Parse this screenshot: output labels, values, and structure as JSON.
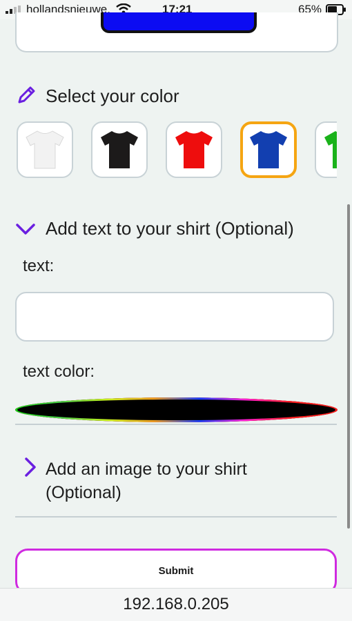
{
  "status_bar": {
    "carrier": "hollandsnieuwe.",
    "time": "17:21",
    "battery_percent": "65%",
    "battery_level": 0.65
  },
  "color_section": {
    "title": "Select your color",
    "icon": "pencil-icon",
    "shirts": [
      {
        "color_name": "white",
        "color": "#f2f2f2",
        "selected": false
      },
      {
        "color_name": "black",
        "color": "#1c1a1a",
        "selected": false
      },
      {
        "color_name": "red",
        "color": "#ee0d0d",
        "selected": false
      },
      {
        "color_name": "blue",
        "color": "#123fb0",
        "selected": true
      },
      {
        "color_name": "green",
        "color": "#1ab21a",
        "selected": false
      }
    ]
  },
  "text_section": {
    "title": "Add text to your shirt (Optional)",
    "expanded": true,
    "text_label": "text:",
    "text_value": "",
    "text_color_label": "text color:",
    "text_color_value": "#000000"
  },
  "image_section": {
    "title_line1": "Add an image to your shirt",
    "title_line2": "(Optional)",
    "expanded": false
  },
  "submit_label": "Submit",
  "url": "192.168.0.205",
  "colors": {
    "accent": "#6a1fe0",
    "selected_border": "#f5a512",
    "submit_border": "#cf2ae0"
  }
}
